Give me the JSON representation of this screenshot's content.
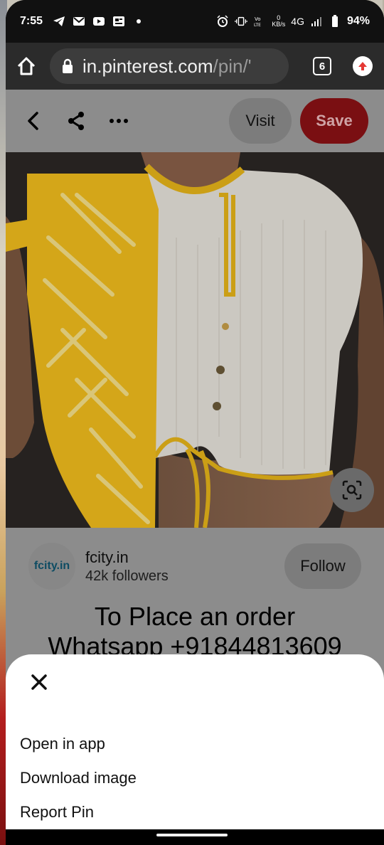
{
  "status_bar": {
    "time": "7:55",
    "network": "4G",
    "data_speed_value": "0",
    "data_speed_unit": "KB/s",
    "battery": "94%"
  },
  "browser": {
    "url_host": "in.pinterest.com",
    "url_path": "/pin/'",
    "tab_count": "6"
  },
  "pin": {
    "visit_label": "Visit",
    "save_label": "Save",
    "creator_avatar_text": "fcity.in",
    "creator_name": "fcity.in",
    "followers": "42k followers",
    "follow_label": "Follow",
    "title_line1": "To Place an order",
    "title_line2": "Whatsapp +91844813609"
  },
  "sheet": {
    "items": [
      "Open in app",
      "Download image",
      "Report Pin"
    ]
  },
  "colors": {
    "save_red": "#e60023",
    "sari_yellow": "#f4c01e",
    "blouse_white": "#ece9e2"
  }
}
